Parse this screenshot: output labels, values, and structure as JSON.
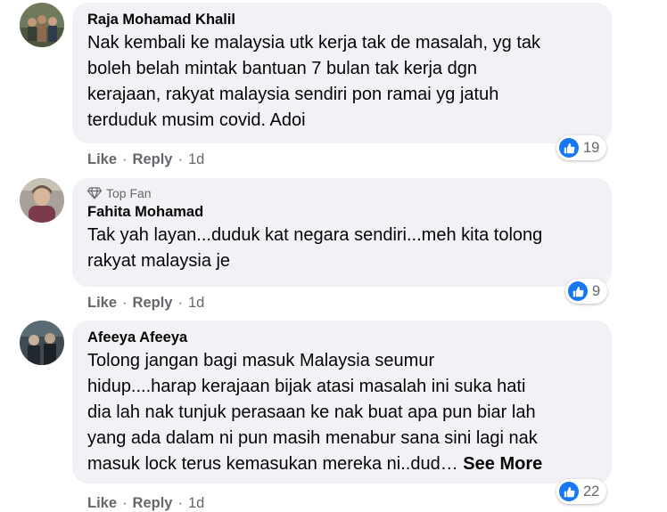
{
  "comments": [
    {
      "author": "Raja Mohamad Khalil",
      "badge": "",
      "lines": [
        "Nak kembali ke malaysia utk kerja tak de masalah, yg tak",
        "boleh belah mintak bantuan 7 bulan tak kerja dgn",
        "kerajaan, rakyat malaysia sendiri pon ramai yg jatuh",
        "terduduk musim covid. Adoi"
      ],
      "reactions": "19",
      "like_label": "Like",
      "reply_label": "Reply",
      "time": "1d"
    },
    {
      "author": "Fahita Mohamad",
      "badge": "Top Fan",
      "lines": [
        "Tak yah layan...duduk kat negara sendiri...meh kita tolong",
        "rakyat malaysia je"
      ],
      "reactions": "9",
      "like_label": "Like",
      "reply_label": "Reply",
      "time": "1d"
    },
    {
      "author": "Afeeya Afeeya",
      "badge": "",
      "lines": [
        "Tolong jangan bagi masuk Malaysia seumur",
        "hidup....harap kerajaan bijak atasi masalah ini suka hati",
        "dia lah nak tunjuk perasaan ke nak buat apa pun biar lah",
        "yang ada dalam ni pun masih menabur sana sini lagi nak",
        "masuk lock terus kemasukan mereka ni..dud…"
      ],
      "see_more": "See More",
      "reactions": "22",
      "like_label": "Like",
      "reply_label": "Reply",
      "time": "1d"
    }
  ],
  "separator": "·",
  "colors": {
    "bubble": "#f0f2f5",
    "like_blue": "#1877f2",
    "meta_gray": "#65676b",
    "text": "#050505"
  },
  "icons": {
    "like": "thumbs-up-icon",
    "top_fan": "diamond-icon"
  }
}
